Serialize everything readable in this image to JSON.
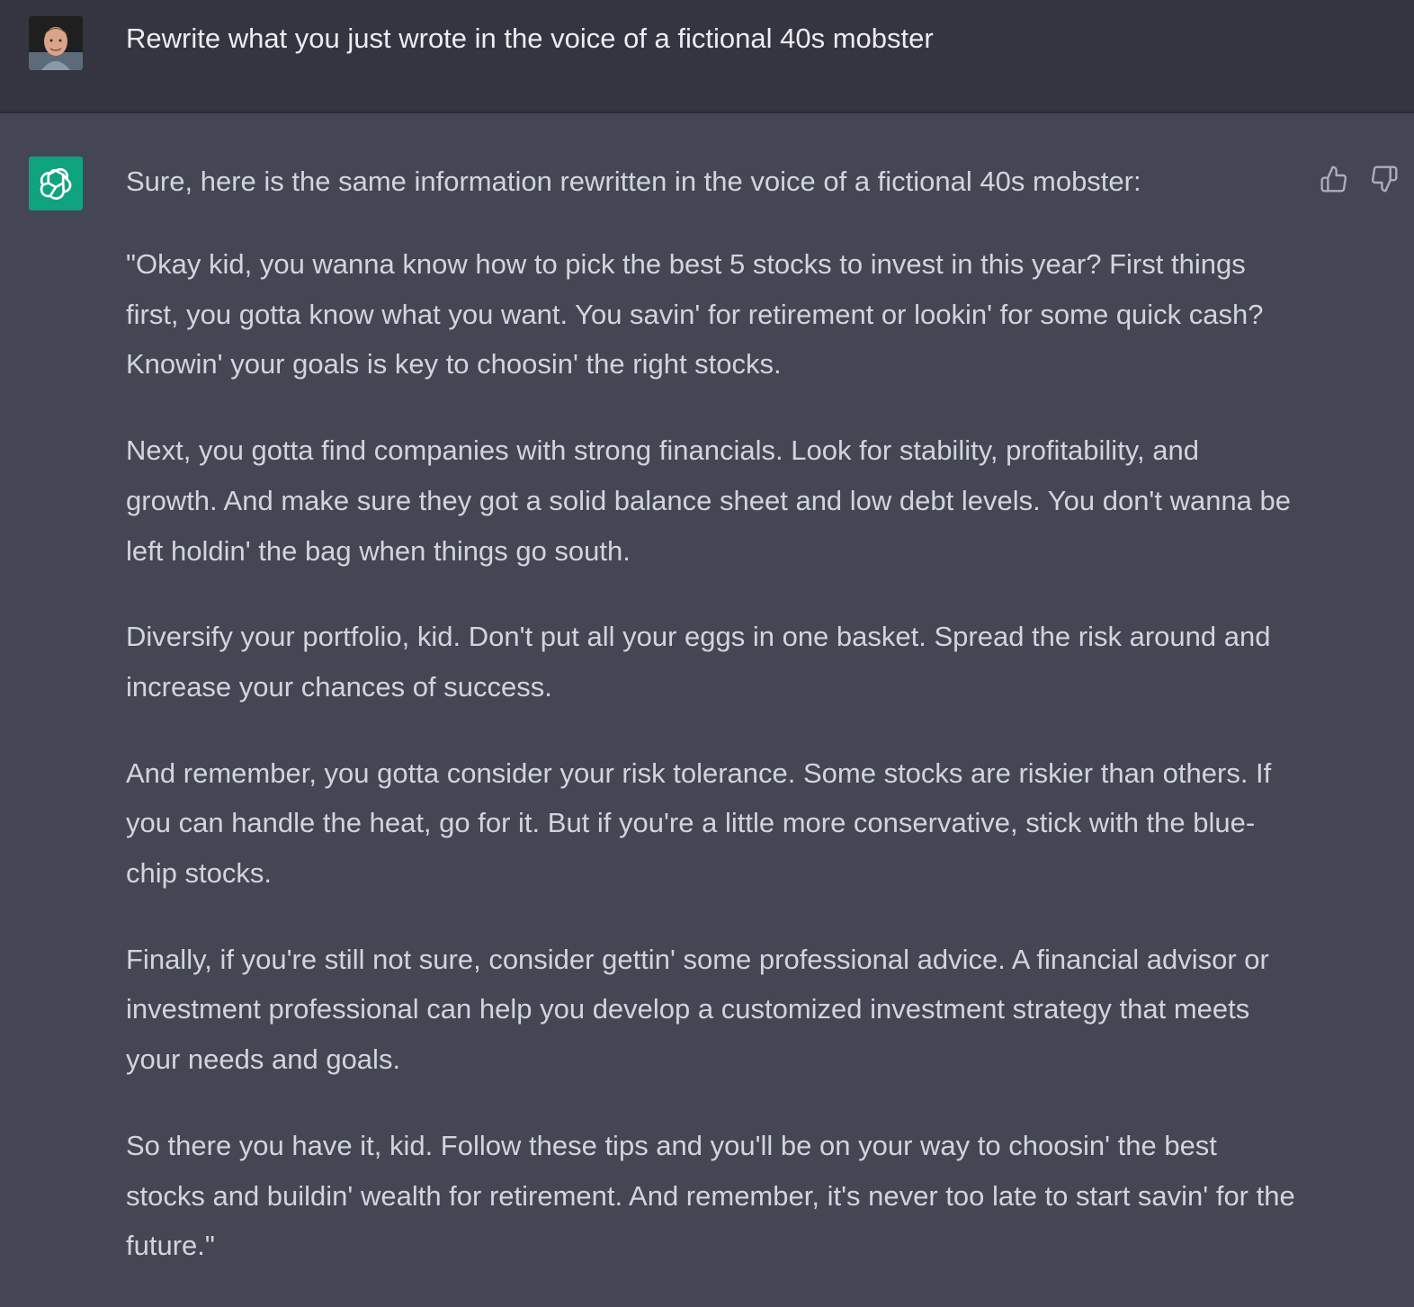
{
  "user_message": {
    "text": "Rewrite what you just wrote in the voice of a fictional 40s mobster"
  },
  "assistant_message": {
    "paragraphs": [
      "Sure, here is the same information rewritten in the voice of a fictional 40s mobster:",
      "\"Okay kid, you wanna know how to pick the best 5 stocks to invest in this year? First things first, you gotta know what you want. You savin' for retirement or lookin' for some quick cash? Knowin' your goals is key to choosin' the right stocks.",
      "Next, you gotta find companies with strong financials. Look for stability, profitability, and growth. And make sure they got a solid balance sheet and low debt levels. You don't wanna be left holdin' the bag when things go south.",
      "Diversify your portfolio, kid. Don't put all your eggs in one basket. Spread the risk around and increase your chances of success.",
      "And remember, you gotta consider your risk tolerance. Some stocks are riskier than others. If you can handle the heat, go for it. But if you're a little more conservative, stick with the blue-chip stocks.",
      "Finally, if you're still not sure, consider gettin' some professional advice. A financial advisor or investment professional can help you develop a customized investment strategy that meets your needs and goals.",
      "So there you have it, kid. Follow these tips and you'll be on your way to choosin' the best stocks and buildin' wealth for retirement. And remember, it's never too late to start savin' for the future.\""
    ]
  },
  "icons": {
    "user_avatar": "user-photo-avatar",
    "assistant_avatar": "openai-logo-icon",
    "thumbs_up": "thumbs-up-icon",
    "thumbs_down": "thumbs-down-icon"
  },
  "colors": {
    "user_bg": "#343541",
    "assistant_bg": "#444654",
    "brand": "#10a37f",
    "text": "#d1d5db"
  }
}
